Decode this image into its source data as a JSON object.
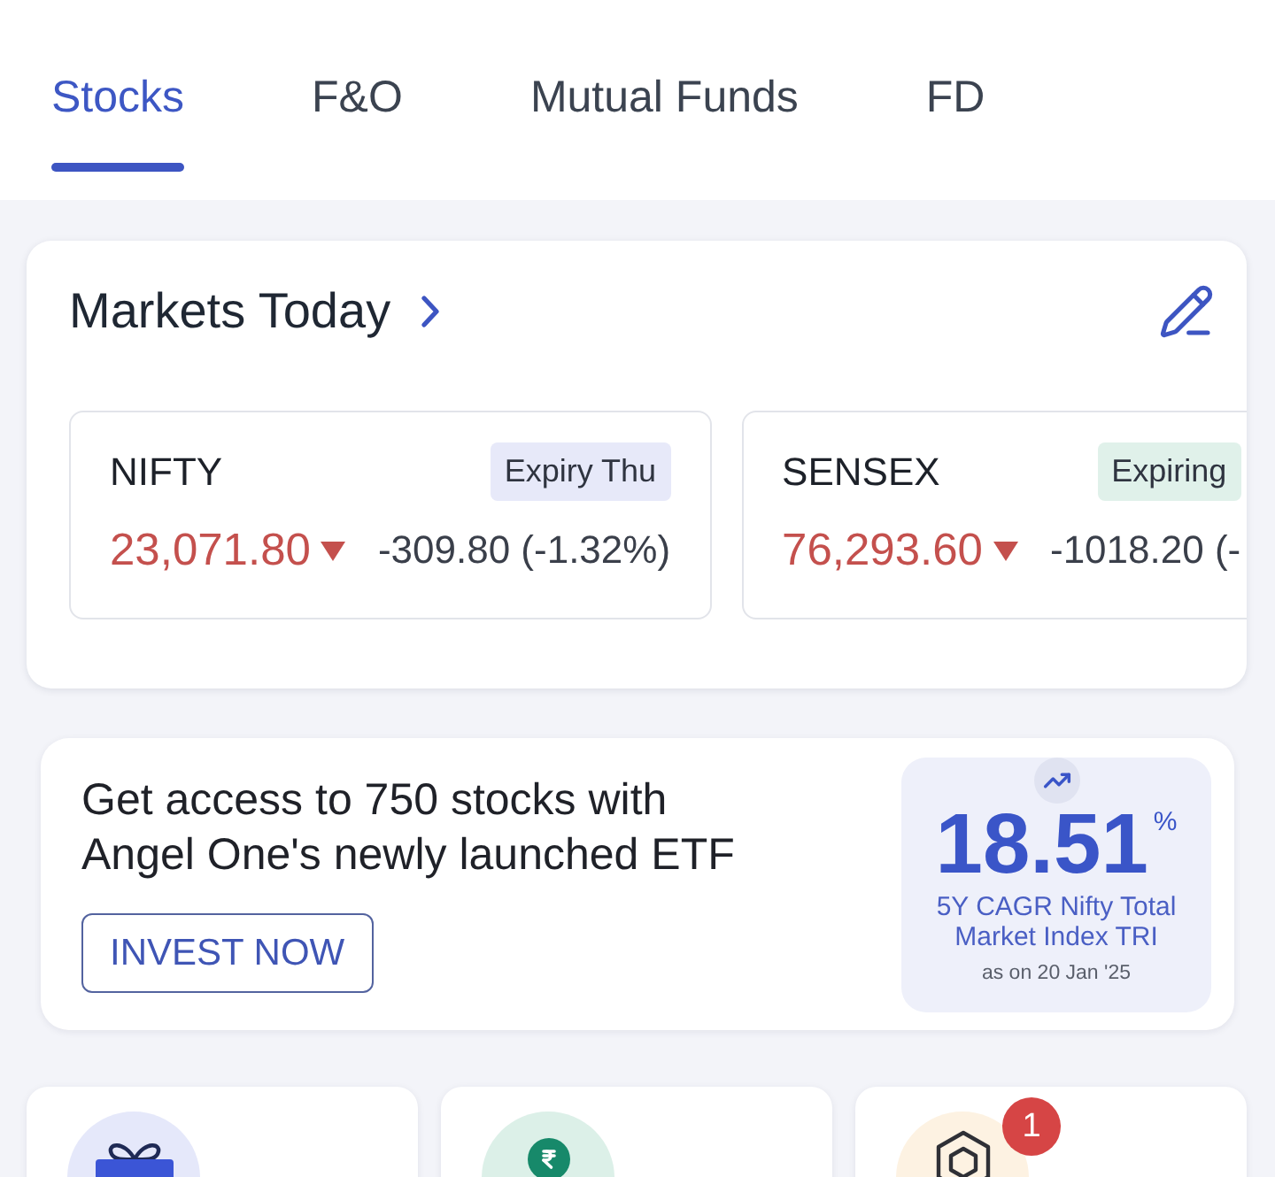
{
  "tabs": [
    {
      "label": "Stocks",
      "selected": true
    },
    {
      "label": "F&O",
      "selected": false
    },
    {
      "label": "Mutual Funds",
      "selected": false
    },
    {
      "label": "FD",
      "selected": false
    }
  ],
  "markets_today": {
    "title": "Markets Today",
    "indices": [
      {
        "name": "NIFTY",
        "badge": {
          "text": "Expiry Thu",
          "color": "#e7e9f9"
        },
        "price": "23,071.80",
        "negative": true,
        "change": "-309.80 (-1.32%)"
      },
      {
        "name": "SENSEX",
        "badge": {
          "text": "Expiring",
          "color": "#e0f1ea"
        },
        "price": "76,293.60",
        "negative": true,
        "change": "-1018.20 (-"
      }
    ]
  },
  "promo": {
    "headline": "Get access to 750 stocks with Angel One's newly launched ETF",
    "button": "INVEST NOW",
    "stat": {
      "value": "18.51",
      "unit": "%",
      "caption": "5Y CAGR Nifty Total Market Index TRI",
      "date": "as on 20 Jan '25"
    }
  },
  "shortcuts": [
    {
      "kind": "gift"
    },
    {
      "kind": "rupee"
    },
    {
      "kind": "hexagon",
      "badge": "1"
    }
  ]
}
